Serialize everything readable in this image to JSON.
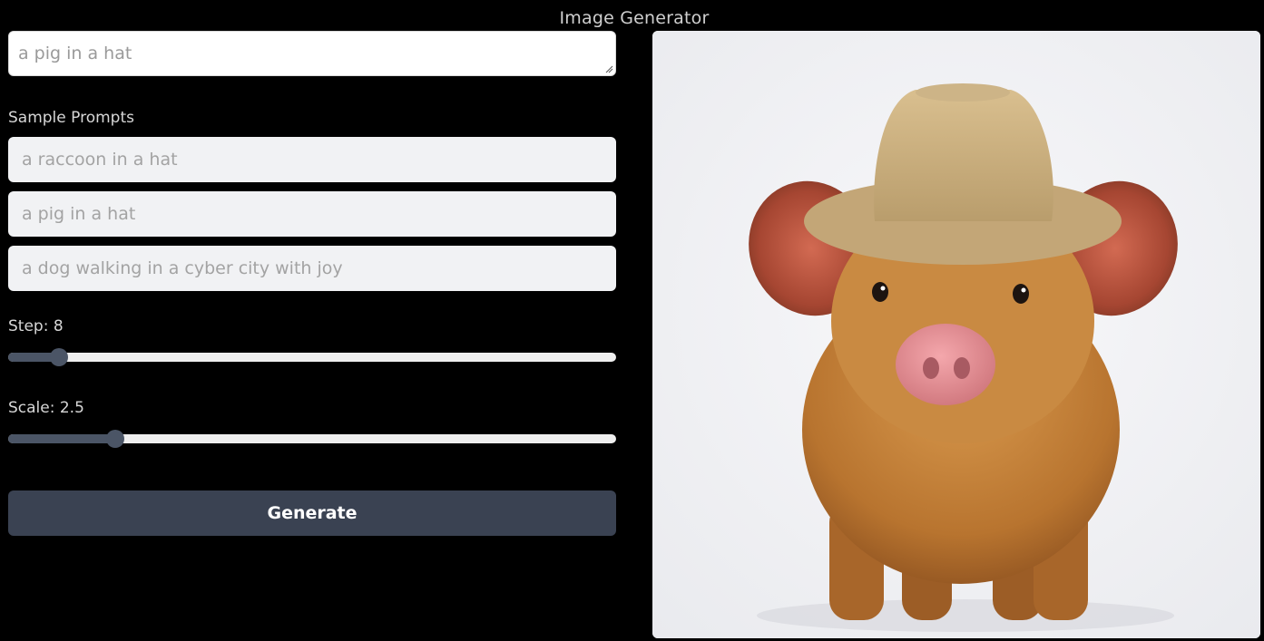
{
  "app": {
    "title": "Image Generator"
  },
  "prompt": {
    "placeholder": "a pig in a hat"
  },
  "samples": {
    "label": "Sample Prompts",
    "items": [
      "a raccoon in a hat",
      "a pig in a hat",
      "a dog walking in a cyber city with joy"
    ]
  },
  "step": {
    "label": "Step: 8",
    "value": 8,
    "min": 1,
    "max": 100
  },
  "scale": {
    "label": "Scale: 2.5",
    "value": 2.5,
    "min": 0,
    "max": 15
  },
  "generate": {
    "label": "Generate"
  },
  "colors": {
    "background": "#000000",
    "button": "#3a4252",
    "slider_accent": "#4b5566",
    "sample_bg": "#f1f2f4"
  }
}
